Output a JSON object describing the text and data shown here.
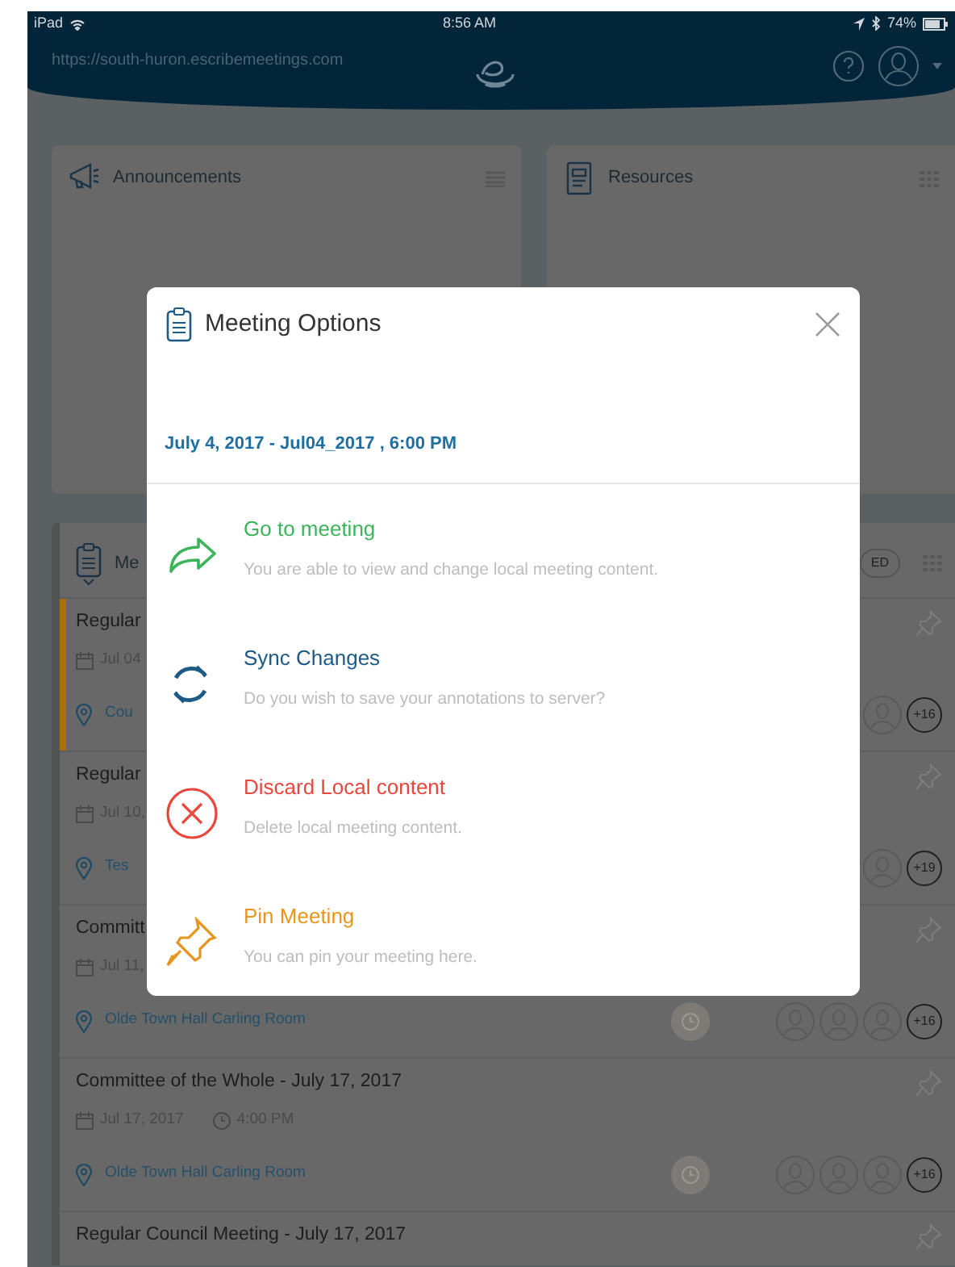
{
  "status_bar": {
    "carrier": "iPad",
    "time": "8:56 AM",
    "battery": "74%"
  },
  "header": {
    "url": "https://south-huron.escribemeetings.com"
  },
  "panels": [
    {
      "title": "Announcements",
      "kind": "announcements"
    },
    {
      "title": "Resources",
      "kind": "resources"
    }
  ],
  "meetings": {
    "title": "Me",
    "toggle": "ED",
    "rows": [
      {
        "title": "Regular",
        "date": "Jul 04",
        "location": "Cou",
        "selected": true,
        "attendees": [
          {
            "kind": "avatar"
          }
        ],
        "count": "+16"
      },
      {
        "title": "Regular",
        "date": "Jul 10,",
        "location": "Tes",
        "selected": false,
        "attendees": [
          {
            "kind": "avatar"
          }
        ],
        "count": "+19"
      },
      {
        "title": "Committ",
        "date": "Jul 11,",
        "location": "Olde Town Hall Carling Room",
        "selected": false,
        "clock": true,
        "attendees": [
          {
            "kind": "avatar"
          },
          {
            "kind": "avatar"
          },
          {
            "kind": "avatar"
          }
        ],
        "count": "+16"
      },
      {
        "title": "Committee of the Whole - July 17, 2017",
        "date": "Jul 17, 2017",
        "time": "4:00 PM",
        "location": "Olde Town Hall Carling Room",
        "selected": false,
        "clock": true,
        "attendees": [
          {
            "kind": "avatar"
          },
          {
            "kind": "avatar"
          },
          {
            "kind": "avatar"
          }
        ],
        "count": "+16"
      },
      {
        "title": "Regular Council Meeting - July 17, 2017",
        "selected": false
      }
    ]
  },
  "modal": {
    "title": "Meeting Options",
    "subtitle": "July 4, 2017 - Jul04_2017 , 6:00 PM",
    "options": [
      {
        "kind": "go",
        "title": "Go to meeting",
        "description": "You are able to view and change local meeting content."
      },
      {
        "kind": "sync",
        "title": "Sync Changes",
        "description": "Do you wish to save your annotations to server?"
      },
      {
        "kind": "discard",
        "title": "Discard Local content",
        "description": "Delete local meeting content."
      },
      {
        "kind": "pin",
        "title": "Pin Meeting",
        "description": "You can pin your meeting here."
      }
    ]
  }
}
